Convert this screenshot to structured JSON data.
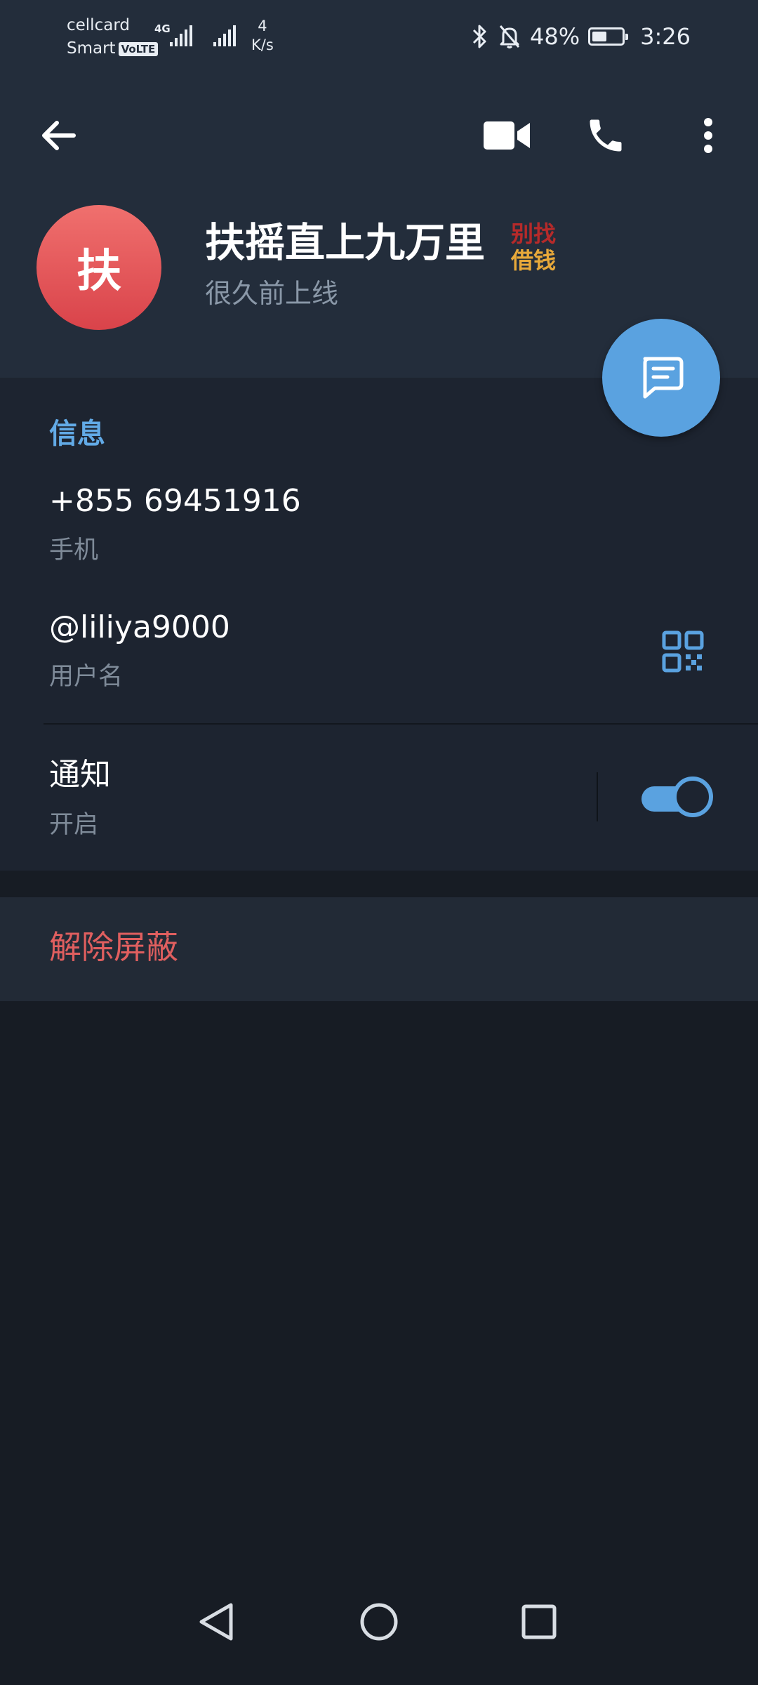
{
  "status_bar": {
    "carrier_line1": "cellcard",
    "carrier_line2": "Smart",
    "volte": "VoLTE",
    "network_type": "4G",
    "net_speed_value": "4",
    "net_speed_unit": "K/s",
    "battery_percent": "48%",
    "time": "3:26",
    "battery_level": 0.48
  },
  "toolbar": {
    "back_icon": "arrow-left-icon",
    "video_icon": "video-camera-icon",
    "call_icon": "phone-icon",
    "more_icon": "more-vertical-icon"
  },
  "profile": {
    "avatar_letter": "扶",
    "name": "扶摇直上九万里",
    "sticker_line1": "别找",
    "sticker_line2": "借钱",
    "last_seen": "很久前上线"
  },
  "info": {
    "section_title": "信息",
    "phone": "+855 69451916",
    "phone_label": "手机",
    "username": "@liliya9000",
    "username_label": "用户名",
    "notifications": "通知",
    "notifications_state": "开启",
    "notifications_enabled": true
  },
  "actions": {
    "unblock": "解除屏蔽"
  },
  "colors": {
    "header_bg": "#232d3b",
    "page_bg": "#171c24",
    "accent": "#5aa2e0",
    "danger": "#e05f5f",
    "avatar": "#e25458"
  }
}
